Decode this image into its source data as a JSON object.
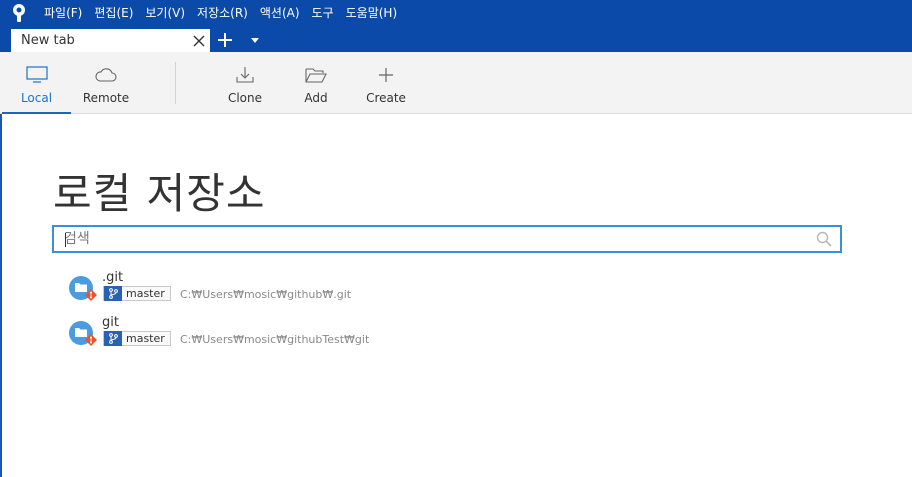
{
  "menu": {
    "items": [
      "파일(F)",
      "편집(E)",
      "보기(V)",
      "저장소(R)",
      "액션(A)",
      "도구",
      "도움말(H)"
    ]
  },
  "tabs": {
    "active_title": "New tab"
  },
  "toolbar": {
    "local": "Local",
    "remote": "Remote",
    "clone": "Clone",
    "add": "Add",
    "create": "Create"
  },
  "main": {
    "title": "로컬 저장소",
    "search_placeholder": "검색",
    "repos": [
      {
        "name": ".git",
        "branch": "master",
        "path": "C:₩Users₩mosic₩github₩.git"
      },
      {
        "name": "git",
        "branch": "master",
        "path": "C:₩Users₩mosic₩githubTest₩git"
      }
    ]
  },
  "colors": {
    "menubar": "#0b4aa8",
    "accent": "#1a73c9",
    "repo_icon": "#4a9be0",
    "repo_badge": "#e8542e"
  }
}
